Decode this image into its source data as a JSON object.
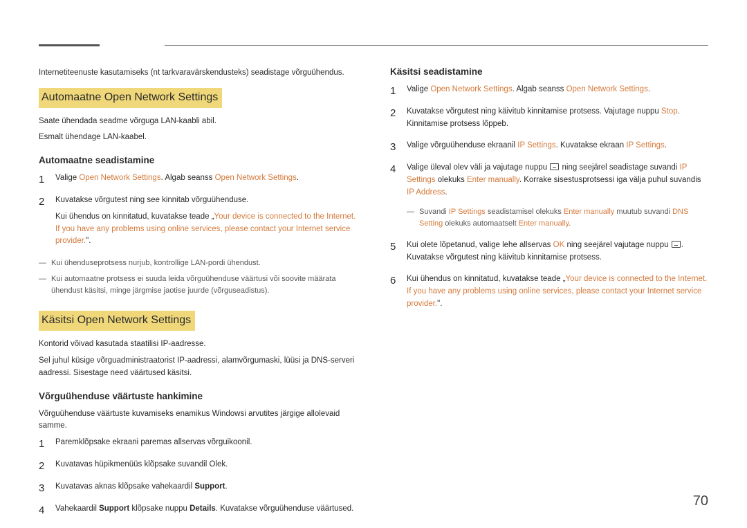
{
  "page_number": "70",
  "left": {
    "intro": "Internetiteenuste kasutamiseks (nt tarkvaravärskendusteks) seadistage võrguühendus.",
    "h2_auto": "Automaatne Open Network Settings",
    "auto_p1": "Saate ühendada seadme võrguga LAN-kaabli abil.",
    "auto_p2": "Esmalt ühendage LAN-kaabel.",
    "h3_auto_set": "Automaatne seadistamine",
    "auto_steps": {
      "s1_pre": "Valige ",
      "s1_k1": "Open Network Settings",
      "s1_mid": ". Algab seanss ",
      "s1_k2": "Open Network Settings",
      "s1_post": ".",
      "s2": "Kuvatakse võrgutest ning see kinnitab võrguühenduse.",
      "s2b_pre": "Kui ühendus on kinnitatud, kuvatakse teade „",
      "s2b_k": "Your device is connected to the Internet. If you have any problems using online services, please contact your Internet service provider.",
      "s2b_post": "\"."
    },
    "auto_note1": "Kui ühenduseprotsess nurjub, kontrollige LAN-pordi ühendust.",
    "auto_note2": "Kui automaatne protsess ei suuda leida võrguühenduse väärtusi või soovite määrata ühendust käsitsi, minge järgmise jaotise juurde (võrguseadistus).",
    "h2_manual": "Käsitsi Open Network Settings",
    "man_p1": "Kontorid võivad kasutada staatilisi IP-aadresse.",
    "man_p2": "Sel juhul küsige võrguadministraatorist IP-aadressi, alamvõrgumaski, lüüsi ja DNS-serveri aadressi. Sisestage need väärtused käsitsi.",
    "h3_values": "Võrguühenduse väärtuste hankimine",
    "values_p": "Võrguühenduse väärtuste kuvamiseks enamikus Windowsi arvutites järgige allolevaid samme.",
    "val_steps": {
      "s1": "Paremklõpsake ekraani paremas allservas võrguikoonil.",
      "s2": "Kuvatavas hüpikmenüüs klõpsake suvandil Olek.",
      "s3_pre": "Kuvatavas aknas klõpsake vahekaardil ",
      "s3_b": "Support",
      "s3_post": ".",
      "s4_pre": "Vahekaardil ",
      "s4_b1": "Support",
      "s4_mid": " klõpsake nuppu ",
      "s4_b2": "Details",
      "s4_post": ". Kuvatakse võrguühenduse väärtused."
    }
  },
  "right": {
    "h3": "Käsitsi seadistamine",
    "steps": {
      "s1_pre": "Valige ",
      "s1_k1": "Open Network Settings",
      "s1_mid": ". Algab seanss ",
      "s1_k2": "Open Network Settings",
      "s1_post": ".",
      "s2_pre": "Kuvatakse võrgutest ning käivitub kinnitamise protsess. Vajutage nuppu ",
      "s2_k": "Stop",
      "s2_post": ". Kinnitamise protsess lõppeb.",
      "s3_pre": "Valige võrguühenduse ekraanil ",
      "s3_k1": "IP Settings",
      "s3_mid": ". Kuvatakse ekraan ",
      "s3_k2": "IP Settings",
      "s3_post": ".",
      "s4_pre": "Valige üleval olev väli ja vajutage nuppu ",
      "s4_mid": " ning seejärel seadistage suvandi ",
      "s4_k1": "IP Settings",
      "s4_mid2": " olekuks ",
      "s4_k2": "Enter manually",
      "s4_mid3": ". Korrake sisestusprotsessi iga välja puhul suvandis ",
      "s4_k3": "IP Address",
      "s4_post": ".",
      "note_pre": "Suvandi ",
      "note_k1": "IP Settings",
      "note_mid1": " seadistamisel olekuks ",
      "note_k2": "Enter manually",
      "note_mid2": " muutub suvandi ",
      "note_k3": "DNS Setting",
      "note_mid3": " olekuks automaatselt ",
      "note_k4": "Enter manually",
      "note_post": ".",
      "s5_pre": "Kui olete lõpetanud, valige lehe allservas ",
      "s5_k": "OK",
      "s5_mid": " ning seejärel vajutage nuppu ",
      "s5_post": ". Kuvatakse võrgutest ning käivitub kinnitamise protsess.",
      "s6_pre": "Kui ühendus on kinnitatud, kuvatakse teade „",
      "s6_k": "Your device is connected to the Internet. If you have any problems using online services, please contact your Internet service provider.",
      "s6_post": "\"."
    }
  }
}
